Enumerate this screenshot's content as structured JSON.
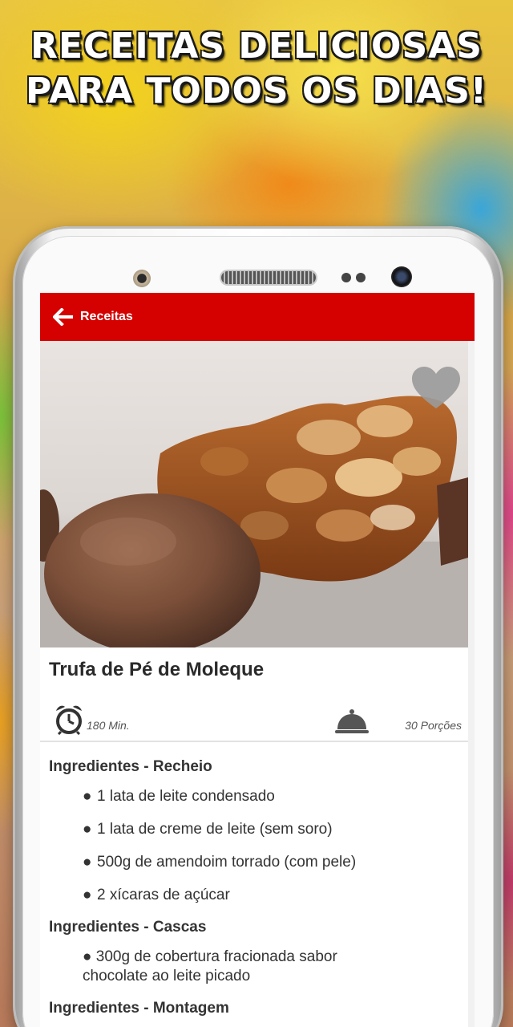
{
  "promo": {
    "line1": "RECEITAS DELICIOSAS",
    "line2": "PARA TODOS OS DIAS!"
  },
  "appbar": {
    "back_icon": "arrow-left-icon",
    "title": "Receitas",
    "color": "#d50000"
  },
  "hero": {
    "favorite_icon": "heart-icon"
  },
  "recipe": {
    "title": "Trufa de Pé de Moleque",
    "time": "180 Min.",
    "time_icon": "alarm-clock-icon",
    "portions": "30 Porções",
    "portions_icon": "cloche-icon"
  },
  "sections": [
    {
      "title": "Ingredientes - Recheio",
      "items": [
        "1 lata de leite condensado",
        "1 lata de creme de leite (sem soro)",
        "500g de amendoim torrado (com pele)",
        "2 xícaras de açúcar"
      ]
    },
    {
      "title": "Ingredientes - Cascas",
      "items": [
        "300g de cobertura fracionada sabor chocolate ao leite picado"
      ]
    },
    {
      "title": "Ingredientes - Montagem",
      "items": []
    }
  ]
}
